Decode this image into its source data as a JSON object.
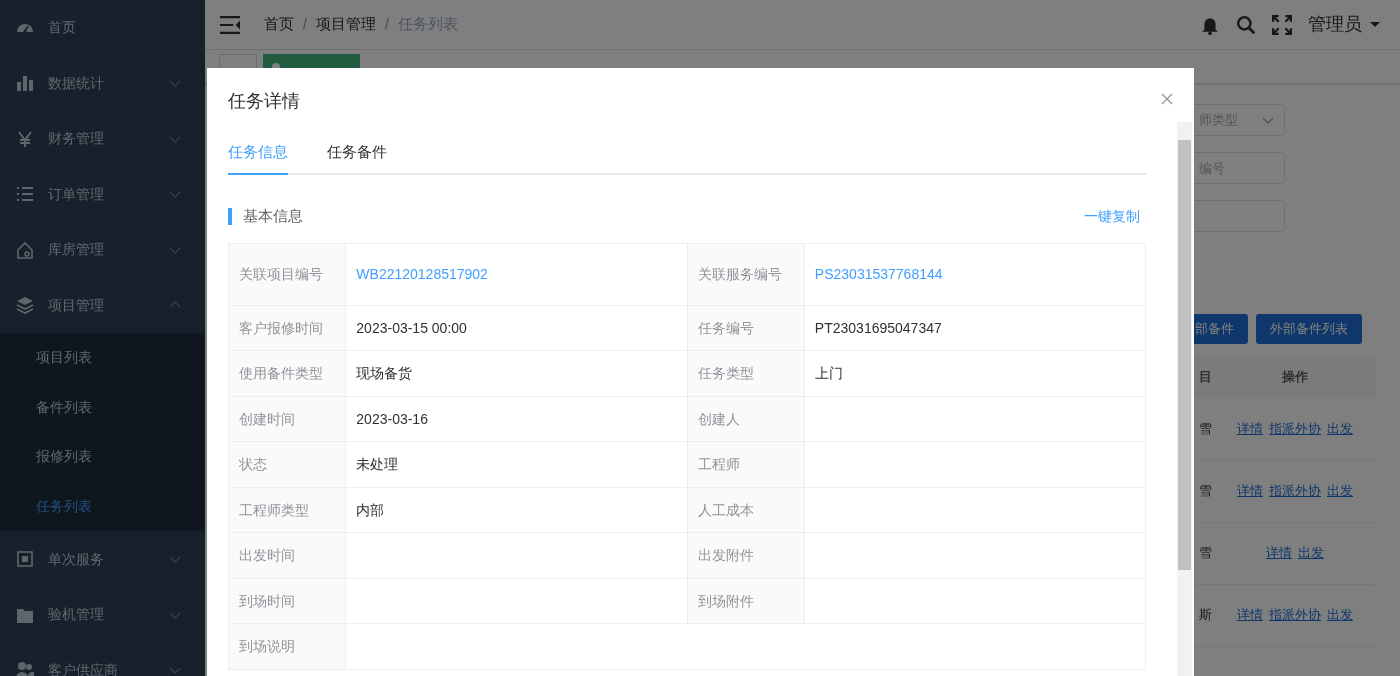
{
  "sidebar": {
    "items": [
      {
        "label": "首页"
      },
      {
        "label": "数据统计",
        "expanded": false
      },
      {
        "label": "财务管理",
        "expanded": false
      },
      {
        "label": "订单管理",
        "expanded": false
      },
      {
        "label": "库房管理",
        "expanded": false
      },
      {
        "label": "项目管理",
        "expanded": true,
        "children": [
          {
            "label": "项目列表",
            "selected": false
          },
          {
            "label": "备件列表",
            "selected": false
          },
          {
            "label": "报修列表",
            "selected": false
          },
          {
            "label": "任务列表",
            "selected": true
          }
        ]
      },
      {
        "label": "单次服务",
        "expanded": false
      },
      {
        "label": "验机管理",
        "expanded": false
      },
      {
        "label": "客户供应商",
        "expanded": false
      }
    ]
  },
  "header": {
    "breadcrumb": [
      {
        "label": "首页"
      },
      {
        "separator": "/",
        "label": "项目管理"
      },
      {
        "separator": "/",
        "label": "任务列表"
      }
    ],
    "user": "管理员"
  },
  "tags": [
    {
      "selected": false
    },
    {
      "selected": true
    }
  ],
  "filters": [
    {
      "placeholder": "师类型",
      "kind": "select"
    },
    {
      "placeholder": "编号",
      "kind": "input"
    },
    {
      "kind": "input"
    }
  ],
  "buttons": [
    "部备件",
    "外部备件列表"
  ],
  "table": {
    "columns": [
      "目",
      "操作"
    ],
    "rows": [
      {
        "column_1": "雪",
        "actions": [
          "详情",
          "指派外协",
          "出发"
        ]
      },
      {
        "column_1": "雪",
        "actions": [
          "详情",
          "指派外协",
          "出发"
        ]
      },
      {
        "column_1": "雪",
        "actions": [
          "详情",
          "出发"
        ]
      },
      {
        "column_1": "斯",
        "actions": [
          "详情",
          "指派外协",
          "出发"
        ]
      }
    ]
  },
  "modal": {
    "title": "任务详情",
    "tabs": [
      {
        "label": "任务信息",
        "selected": true
      },
      {
        "label": "任务备件",
        "selected": false
      }
    ],
    "section_title": "基本信息",
    "copy_link": "一键复制",
    "rows": [
      [
        {
          "label": "关联项目编号",
          "value": "WB22120128517902",
          "kind": "link"
        },
        {
          "label": "关联服务编号",
          "value": "PS23031537768144",
          "kind": "link"
        }
      ],
      [
        {
          "label": "客户报修时间",
          "value": "2023-03-15 00:00",
          "kind": "text"
        },
        {
          "label": "任务编号",
          "value": "PT23031695047347",
          "kind": "text"
        }
      ],
      [
        {
          "label": "使用备件类型",
          "value": "现场备货",
          "kind": "text"
        },
        {
          "label": "任务类型",
          "value": "上门",
          "kind": "text"
        }
      ],
      [
        {
          "label": "创建时间",
          "value": "2023-03-16",
          "kind": "text"
        },
        {
          "label": "创建人",
          "kind": "text"
        }
      ],
      [
        {
          "label": "状态",
          "value": "未处理",
          "kind": "text"
        },
        {
          "label": "工程师",
          "kind": "text"
        }
      ],
      [
        {
          "label": "工程师类型",
          "value": "内部",
          "kind": "text"
        },
        {
          "label": "人工成本",
          "kind": "text"
        }
      ],
      [
        {
          "label": "出发时间",
          "kind": "text"
        },
        {
          "label": "出发附件",
          "kind": "text"
        }
      ],
      [
        {
          "label": "到场时间",
          "kind": "text"
        },
        {
          "label": "到场附件",
          "kind": "text"
        }
      ],
      [
        {
          "label": "到场说明",
          "kind": "text"
        }
      ]
    ]
  }
}
